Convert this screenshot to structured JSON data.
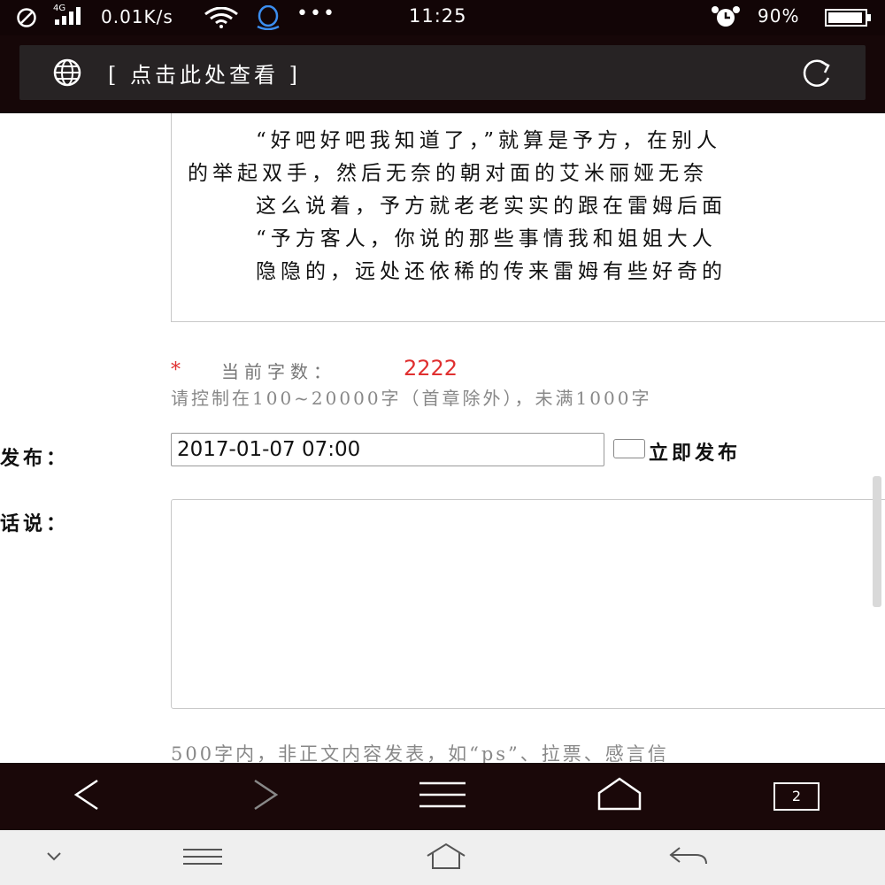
{
  "status_bar": {
    "network_type": "4G",
    "speed": "0.01K/s",
    "more": "•••",
    "time": "11:25",
    "battery": "90%"
  },
  "address_bar": {
    "url_text": "[ 点击此处查看 ]"
  },
  "article": {
    "lines": [
      "“好吧好吧我知道了，”就算是予方，在别人",
      "的举起双手，然后无奈的朝对面的艾米丽娅无奈",
      "这么说着，予方就老老实实的跟在雷姆后面",
      "“予方客人，你说的那些事情我和姐姐大人",
      "隐隐的，远处还依稀的传来雷姆有些好奇的"
    ]
  },
  "word_count": {
    "star": "*",
    "label": "当前字数：",
    "value": "2222",
    "hint": "请控制在100~20000字（首章除外），未满1000字"
  },
  "publish": {
    "label": "发布：",
    "datetime": "2017-01-07 07:00",
    "immediate_label": "立即发布"
  },
  "author_words": {
    "label": "话说：",
    "value": "",
    "hint": "500字内，非正文内容发表，如“ps”、拉票、感言信"
  },
  "browser_toolbar": {
    "tabs_count": "2"
  },
  "colors": {
    "status_bar_bg": "#120506",
    "toolbar_bg": "#1a0809",
    "accent_red": "#e03030",
    "nav_bar_bg": "#efefef"
  },
  "icons": [
    "no-sim-icon",
    "signal-icon",
    "wifi-icon",
    "qq-icon",
    "alarm-icon",
    "battery-icon",
    "globe-icon",
    "refresh-icon",
    "back-icon",
    "forward-icon",
    "menu-icon",
    "home-icon",
    "tabs-icon",
    "chevron-down-icon",
    "hamburger-icon",
    "home-outline-icon",
    "return-icon"
  ]
}
